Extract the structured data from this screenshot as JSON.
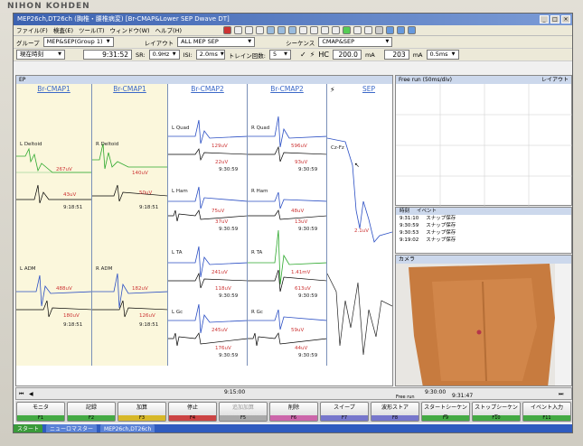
{
  "brand": "NIHON KOHDEN",
  "window": {
    "title": "MEP26ch,DT26ch (胸椎・腰椎病変) [Br-CMAP&Lower SEP Dwave DT]"
  },
  "menu": [
    "ファイル(F)",
    "検査(E)",
    "ツール(T)",
    "ウィンドウ(W)",
    "ヘルプ(H)"
  ],
  "toolbar1": {
    "group_label": "グループ",
    "group_value": "MEP&SEP(Group 1)",
    "layout_label": "レイアウト",
    "layout_value": "ALL MEP SEP",
    "sequence_label": "シーケンス",
    "sequence_value": "CMAP&SEP"
  },
  "toolbar2": {
    "time_mode": "現在時刻",
    "time_value": "9:31:52",
    "sr_label": "SR:",
    "sr_value": "0.9Hz",
    "isi_label": "ISI:",
    "isi_value": "2.0ms",
    "train_label": "トレイン回数:",
    "train_value": "5",
    "hc_label": "HC",
    "hc_value": "200.0",
    "hc_unit": "mA",
    "current_value": "203",
    "current_unit": "mA",
    "duration_value": "0.5ms"
  },
  "ep_panel": {
    "header": "EP"
  },
  "columns": [
    {
      "title": "Br-CMAP1",
      "channels": [
        {
          "name": "L Deltoid",
          "amp": "267uV",
          "time": "9:18:51",
          "value2": "43uV"
        },
        {
          "name": "L ADM",
          "amp": "488uV",
          "time": "9:18:51",
          "value2": "180uV"
        }
      ]
    },
    {
      "title": "Br-CMAP1",
      "channels": [
        {
          "name": "R Deltoid",
          "amp": "140uV",
          "time": "9:18:51",
          "value2": "50uV"
        },
        {
          "name": "R ADM",
          "amp": "182uV",
          "time": "9:18:51",
          "value2": "126uV"
        }
      ]
    },
    {
      "title": "Br-CMAP2",
      "channels": [
        {
          "name": "L Quad",
          "amp": "129uV",
          "time": "9:30:59",
          "value2": "22uV"
        },
        {
          "name": "L Ham",
          "amp": "75uV",
          "time": "9:30:59",
          "value2": "37uV"
        },
        {
          "name": "L TA",
          "amp": "241uV",
          "time": "9:30:59",
          "value2": "118uV"
        },
        {
          "name": "L Gc",
          "amp": "245uV",
          "time": "9:30:59",
          "value2": "176uV"
        }
      ]
    },
    {
      "title": "Br-CMAP2",
      "channels": [
        {
          "name": "R Quad",
          "amp": "596uV",
          "time": "9:30:59",
          "value2": "93uV"
        },
        {
          "name": "R Ham",
          "amp": "48uV",
          "time": "9:30:59",
          "value2": "13uV"
        },
        {
          "name": "R TA",
          "amp": "1.41mV",
          "time": "9:30:59",
          "value2": "613uV"
        },
        {
          "name": "R Gc",
          "amp": "59uV",
          "time": "9:30:59",
          "value2": "44uV"
        }
      ]
    },
    {
      "title": "SEP",
      "channels": [
        {
          "name": "Cz-Fz",
          "amp": "2.1uV",
          "time": "",
          "value2": ""
        }
      ]
    }
  ],
  "freerun": {
    "header": "Free run (50ms/div)",
    "title": "レイアウト"
  },
  "events": {
    "header_time": "時刻",
    "header_event": "イベント",
    "rows": [
      {
        "time": "9:31:10",
        "event": "スナップ保存"
      },
      {
        "time": "9:30:59",
        "event": "スナップ保存"
      },
      {
        "time": "9:30:53",
        "event": "スナップ保存"
      },
      {
        "time": "9:19:02",
        "event": "スナップ保存"
      }
    ]
  },
  "camera": {
    "header": "カメラ"
  },
  "timeline": {
    "t1": "9:15:00",
    "t2": "9:30:00",
    "current": "9:31:47",
    "free_run": "Free run"
  },
  "fkeys": [
    {
      "label": "モニタ",
      "f": "F1",
      "color": "#44aa44"
    },
    {
      "label": "記録",
      "f": "F2",
      "color": "#44aa44"
    },
    {
      "label": "加算",
      "f": "F3",
      "color": "#d7b829"
    },
    {
      "label": "停止",
      "f": "F4",
      "color": "#cc4444"
    },
    {
      "label": "追加加算",
      "f": "F5",
      "color": "#aaaaaa"
    },
    {
      "label": "削除",
      "f": "F6",
      "color": "#cc66aa"
    },
    {
      "label": "スイープ",
      "f": "F7",
      "color": "#7777cc"
    },
    {
      "label": "波形ストア",
      "f": "F8",
      "color": "#7777cc"
    },
    {
      "label": "スタートシーケンス",
      "f": "F9",
      "color": "#44aa44"
    },
    {
      "label": "ストップシーケンス",
      "f": "F10",
      "color": "#44aa44"
    },
    {
      "label": "イベント入力",
      "f": "F11",
      "color": "#44aa44"
    }
  ],
  "taskbar": {
    "start": "スタート",
    "items": [
      "ニューロマスター",
      "MEP26ch,DT26ch"
    ]
  }
}
